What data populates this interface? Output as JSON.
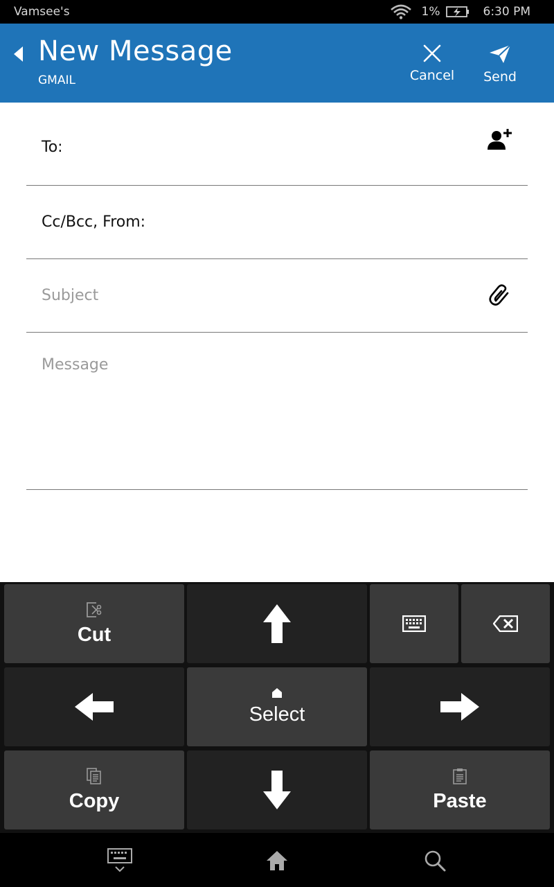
{
  "status_bar": {
    "carrier": "Vamsee's",
    "battery_percent": "1%",
    "time": "6:30 PM",
    "icons": [
      "wifi-icon",
      "battery-charging-icon"
    ]
  },
  "header": {
    "title": "New Message",
    "subtitle": "GMAIL",
    "cancel_label": "Cancel",
    "send_label": "Send",
    "color": "#1f74b8"
  },
  "compose": {
    "to_label": "To:",
    "cc_label": "Cc/Bcc, From:",
    "subject_placeholder": "Subject",
    "message_placeholder": "Message"
  },
  "keyboard": {
    "cut_label": "Cut",
    "copy_label": "Copy",
    "paste_label": "Paste",
    "select_label": "Select",
    "icons": [
      "cut-icon",
      "arrow-up-icon",
      "keyboard-icon",
      "backspace-icon",
      "arrow-left-icon",
      "arrow-right-icon",
      "copy-icon",
      "arrow-down-icon",
      "paste-icon"
    ]
  },
  "nav_bar": {
    "icons": [
      "hide-keyboard-icon",
      "home-icon",
      "search-icon"
    ]
  }
}
